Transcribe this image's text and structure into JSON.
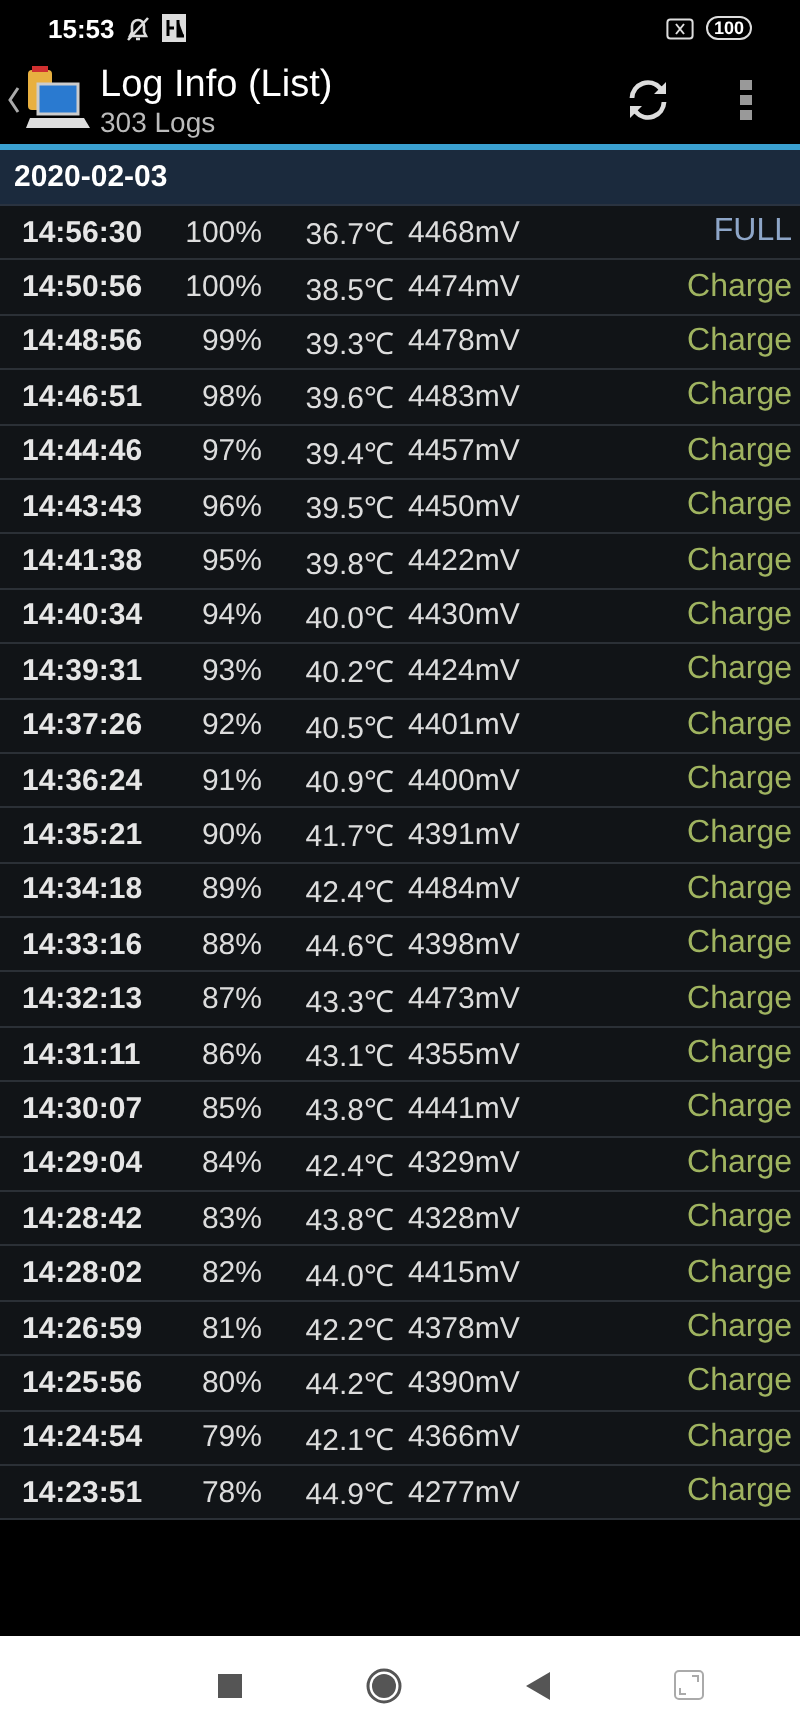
{
  "status_bar": {
    "time": "15:53",
    "battery": "100"
  },
  "header": {
    "title": "Log Info (List)",
    "subtitle": "303 Logs"
  },
  "date_header": "2020-02-03",
  "rows": [
    {
      "time": "14:56:30",
      "percent": "100%",
      "temp": "36.7℃",
      "voltage": "4468mV",
      "status": "FULL",
      "kind": "full"
    },
    {
      "time": "14:50:56",
      "percent": "100%",
      "temp": "38.5℃",
      "voltage": "4474mV",
      "status": "Charge",
      "kind": "charge"
    },
    {
      "time": "14:48:56",
      "percent": "99%",
      "temp": "39.3℃",
      "voltage": "4478mV",
      "status": "Charge",
      "kind": "charge"
    },
    {
      "time": "14:46:51",
      "percent": "98%",
      "temp": "39.6℃",
      "voltage": "4483mV",
      "status": "Charge",
      "kind": "charge"
    },
    {
      "time": "14:44:46",
      "percent": "97%",
      "temp": "39.4℃",
      "voltage": "4457mV",
      "status": "Charge",
      "kind": "charge"
    },
    {
      "time": "14:43:43",
      "percent": "96%",
      "temp": "39.5℃",
      "voltage": "4450mV",
      "status": "Charge",
      "kind": "charge"
    },
    {
      "time": "14:41:38",
      "percent": "95%",
      "temp": "39.8℃",
      "voltage": "4422mV",
      "status": "Charge",
      "kind": "charge"
    },
    {
      "time": "14:40:34",
      "percent": "94%",
      "temp": "40.0℃",
      "voltage": "4430mV",
      "status": "Charge",
      "kind": "charge"
    },
    {
      "time": "14:39:31",
      "percent": "93%",
      "temp": "40.2℃",
      "voltage": "4424mV",
      "status": "Charge",
      "kind": "charge"
    },
    {
      "time": "14:37:26",
      "percent": "92%",
      "temp": "40.5℃",
      "voltage": "4401mV",
      "status": "Charge",
      "kind": "charge"
    },
    {
      "time": "14:36:24",
      "percent": "91%",
      "temp": "40.9℃",
      "voltage": "4400mV",
      "status": "Charge",
      "kind": "charge"
    },
    {
      "time": "14:35:21",
      "percent": "90%",
      "temp": "41.7℃",
      "voltage": "4391mV",
      "status": "Charge",
      "kind": "charge"
    },
    {
      "time": "14:34:18",
      "percent": "89%",
      "temp": "42.4℃",
      "voltage": "4484mV",
      "status": "Charge",
      "kind": "charge"
    },
    {
      "time": "14:33:16",
      "percent": "88%",
      "temp": "44.6℃",
      "voltage": "4398mV",
      "status": "Charge",
      "kind": "charge"
    },
    {
      "time": "14:32:13",
      "percent": "87%",
      "temp": "43.3℃",
      "voltage": "4473mV",
      "status": "Charge",
      "kind": "charge"
    },
    {
      "time": "14:31:11",
      "percent": "86%",
      "temp": "43.1℃",
      "voltage": "4355mV",
      "status": "Charge",
      "kind": "charge"
    },
    {
      "time": "14:30:07",
      "percent": "85%",
      "temp": "43.8℃",
      "voltage": "4441mV",
      "status": "Charge",
      "kind": "charge"
    },
    {
      "time": "14:29:04",
      "percent": "84%",
      "temp": "42.4℃",
      "voltage": "4329mV",
      "status": "Charge",
      "kind": "charge"
    },
    {
      "time": "14:28:42",
      "percent": "83%",
      "temp": "43.8℃",
      "voltage": "4328mV",
      "status": "Charge",
      "kind": "charge"
    },
    {
      "time": "14:28:02",
      "percent": "82%",
      "temp": "44.0℃",
      "voltage": "4415mV",
      "status": "Charge",
      "kind": "charge"
    },
    {
      "time": "14:26:59",
      "percent": "81%",
      "temp": "42.2℃",
      "voltage": "4378mV",
      "status": "Charge",
      "kind": "charge"
    },
    {
      "time": "14:25:56",
      "percent": "80%",
      "temp": "44.2℃",
      "voltage": "4390mV",
      "status": "Charge",
      "kind": "charge"
    },
    {
      "time": "14:24:54",
      "percent": "79%",
      "temp": "42.1℃",
      "voltage": "4366mV",
      "status": "Charge",
      "kind": "charge"
    },
    {
      "time": "14:23:51",
      "percent": "78%",
      "temp": "44.9℃",
      "voltage": "4277mV",
      "status": "Charge",
      "kind": "charge"
    }
  ]
}
